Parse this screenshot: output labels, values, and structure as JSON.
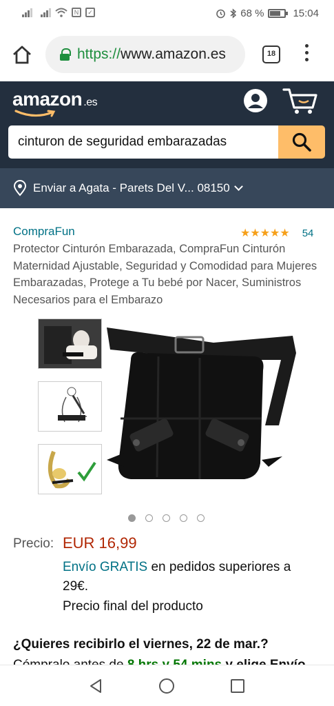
{
  "status_bar": {
    "battery_percent": "68 %",
    "time": "15:04",
    "icons": [
      "signal-icon",
      "signal-icon",
      "wifi-icon",
      "nfc-icon",
      "screenshot-icon",
      "alarm-icon",
      "bluetooth-icon",
      "battery-icon"
    ]
  },
  "browser": {
    "url_scheme": "https://",
    "url_host": "www.amazon.es",
    "tab_count": "18"
  },
  "amazon_header": {
    "logo_text": "amazon",
    "logo_tld": ".es",
    "search_value": "cinturon de seguridad embarazadas",
    "accent_color": "#febd69",
    "bg_color": "#232f3e"
  },
  "delivery_bar": {
    "text": "Enviar a Agata - Parets Del V... 08150"
  },
  "product": {
    "brand": "CompraFun",
    "stars": "★★★★★",
    "rating_value": 4.5,
    "rating_count": "54",
    "title": "Protector Cinturón Embarazada, CompraFun Cinturón Maternidad Ajustable, Seguridad y Comodidad para Mujeres Embarazadas, Protege a Tu bebé por Nacer, Suministros Necesarios para el Embarazo",
    "image_count": 5,
    "active_image_index": 0,
    "price_label": "Precio:",
    "price": "EUR 16,99",
    "shipping_link": "Envío GRATIS",
    "shipping_rest": " en pedidos superiores a 29€.",
    "final_price_note": "Precio final del producto",
    "delivery_question": "¿Quieres recibirlo el viernes, 22 de mar.?",
    "delivery_prefix": "Cómpralo antes de ",
    "delivery_time": "8 hrs y 54 mins",
    "delivery_suffix": " y elige Envío"
  },
  "nav_bar": {
    "icons": [
      "back-icon",
      "home-circle-icon",
      "recent-apps-icon"
    ]
  }
}
